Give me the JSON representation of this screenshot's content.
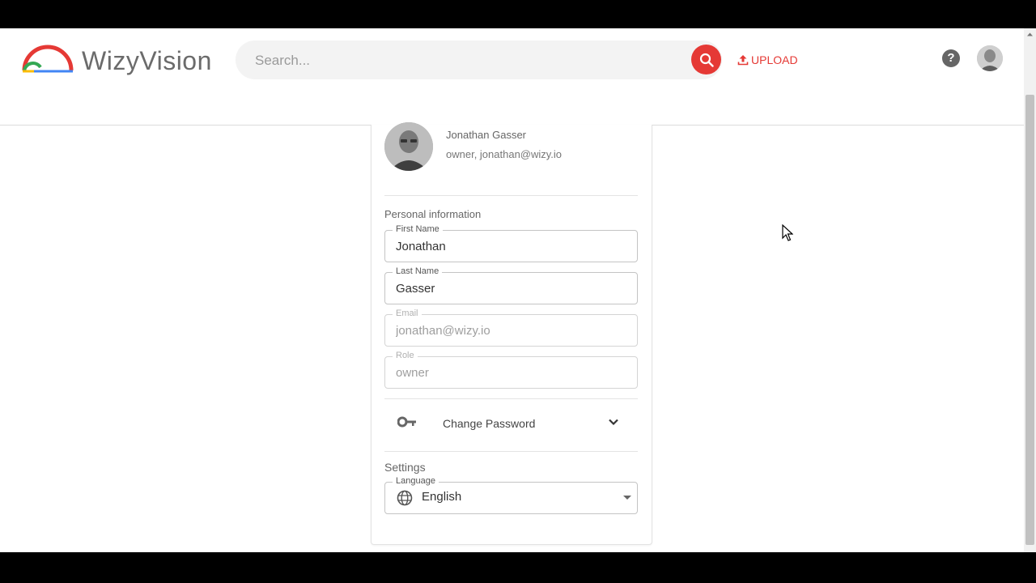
{
  "header": {
    "logo_text": "WizyVision",
    "search_placeholder": "Search...",
    "upload_label": "UPLOAD",
    "help_symbol": "?"
  },
  "profile": {
    "name": "Jonathan Gasser",
    "subtitle": "owner, jonathan@wizy.io"
  },
  "personal_info": {
    "section_label": "Personal information",
    "first_name": {
      "label": "First Name",
      "value": "Jonathan"
    },
    "last_name": {
      "label": "Last Name",
      "value": "Gasser"
    },
    "email": {
      "label": "Email",
      "value": "jonathan@wizy.io"
    },
    "role": {
      "label": "Role",
      "value": "owner"
    }
  },
  "password": {
    "label": "Change Password"
  },
  "settings": {
    "section_label": "Settings",
    "language": {
      "label": "Language",
      "value": "English"
    }
  },
  "colors": {
    "accent": "#e53935",
    "logo_green": "#34a853",
    "logo_blue": "#4285f4",
    "logo_yellow": "#fbbc05"
  },
  "icons": [
    "search-icon",
    "upload-icon",
    "help-icon",
    "key-icon",
    "chevron-down-icon",
    "globe-icon",
    "cursor-icon"
  ]
}
